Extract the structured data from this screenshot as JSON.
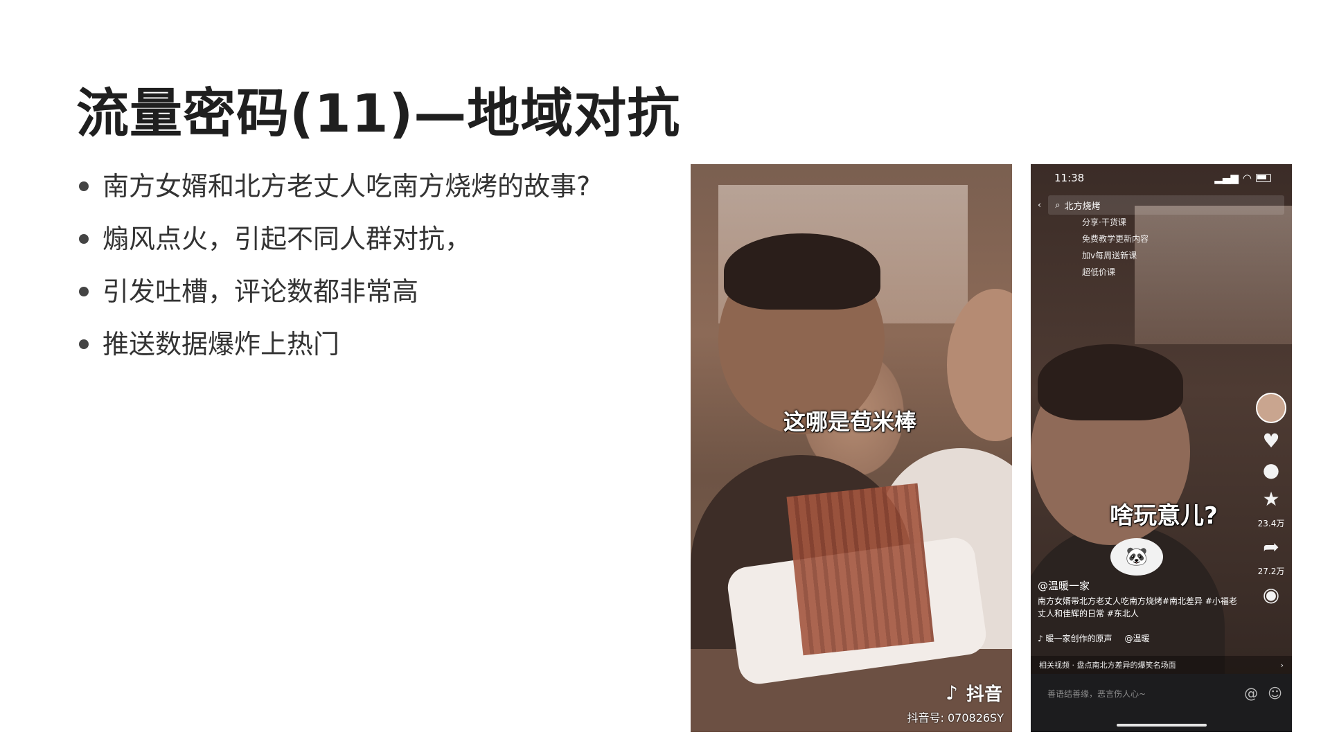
{
  "slide": {
    "title": "流量密码(11)—地域对抗",
    "bullets": [
      "南方女婿和北方老丈人吃南方烧烤的故事?",
      "煽风点火，引起不同人群对抗，",
      "引发吐槽，评论数都非常高",
      "推送数据爆炸上热门"
    ]
  },
  "video_left": {
    "caption": "这哪是苞米棒",
    "logo_text": "抖音",
    "douyin_id": "抖音号: 070826SY"
  },
  "video_right": {
    "status_time": "11:38",
    "search_text": "北方烧烤",
    "overlay_lines": [
      "分享·干货课",
      "免费教学更新内容",
      "加v每周送新课",
      "超低价课"
    ],
    "caption": "啥玩意儿?",
    "username": "@温暖一家",
    "description": "南方女婿带北方老丈人吃南方烧烤#南北差异 #小福老丈人和佳辉的日常 #东北人",
    "music": "♪ 暖一家创作的原声",
    "music_author": "@温暖",
    "likes": "23.4万",
    "shares": "27.2万",
    "related": "相关视频 · 盘点南北方差异的爆笑名场面",
    "comment_placeholder": "善语结善缘，恶言伤人心~",
    "at_icon": "@",
    "emoji_icon": "☺"
  }
}
